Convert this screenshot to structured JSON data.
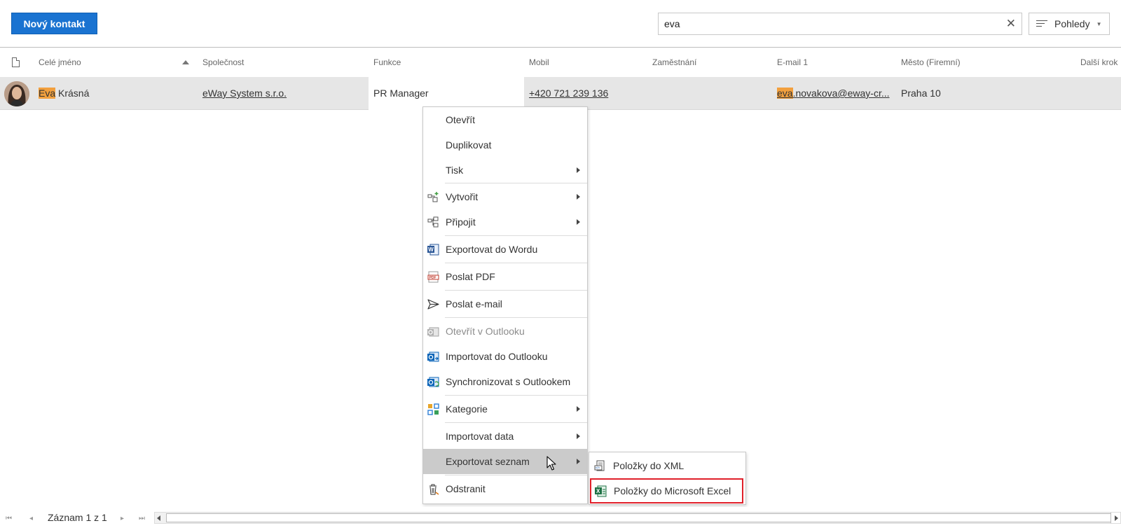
{
  "toolbar": {
    "new_contact_label": "Nový kontakt",
    "search_value": "eva",
    "views_label": "Pohledy"
  },
  "columns": {
    "full_name": "Celé jméno",
    "company": "Společnost",
    "function": "Funkce",
    "mobile": "Mobil",
    "employment": "Zaměstnání",
    "email1": "E-mail 1",
    "city": "Město (Firemní)",
    "next_step": "Další krok"
  },
  "row": {
    "name_highlight": "Eva",
    "name_rest": " Krásná",
    "company": "eWay System s.r.o.",
    "function": "PR Manager",
    "mobile": "+420 721 239 136",
    "email_highlight": "eva",
    "email_rest": ".novakova@eway-cr...",
    "city": "Praha 10"
  },
  "context_menu": {
    "open": "Otevřít",
    "duplicate": "Duplikovat",
    "print": "Tisk",
    "create": "Vytvořit",
    "attach": "Připojit",
    "export_word": "Exportovat do Wordu",
    "send_pdf": "Poslat PDF",
    "send_email": "Poslat e-mail",
    "open_outlook": "Otevřít v Outlooku",
    "import_outlook": "Importovat do Outlooku",
    "sync_outlook": "Synchronizovat s Outlookem",
    "categories": "Kategorie",
    "import_data": "Importovat data",
    "export_list": "Exportovat seznam",
    "delete": "Odstranit"
  },
  "submenu": {
    "xml": "Položky do XML",
    "excel": "Položky do Microsoft Excel"
  },
  "footer": {
    "record_text": "Záznam 1 z 1"
  },
  "colors": {
    "primary": "#1a73d1",
    "highlight": "#f2a03e",
    "row_selected": "#e6e6e6",
    "menu_active": "#cbcbcb",
    "focus_border": "#e0202a"
  },
  "icons": [
    "file-icon",
    "sort-asc-icon",
    "clear-icon",
    "views-icon",
    "chevron-down-icon",
    "create-icon",
    "attach-icon",
    "word-icon",
    "pdf-icon",
    "send-icon",
    "outlook-icon",
    "outlook-import-icon",
    "outlook-sync-icon",
    "category-icon",
    "delete-icon",
    "xml-icon",
    "excel-icon",
    "first-page-icon",
    "prev-page-icon",
    "next-page-icon",
    "last-page-icon"
  ]
}
